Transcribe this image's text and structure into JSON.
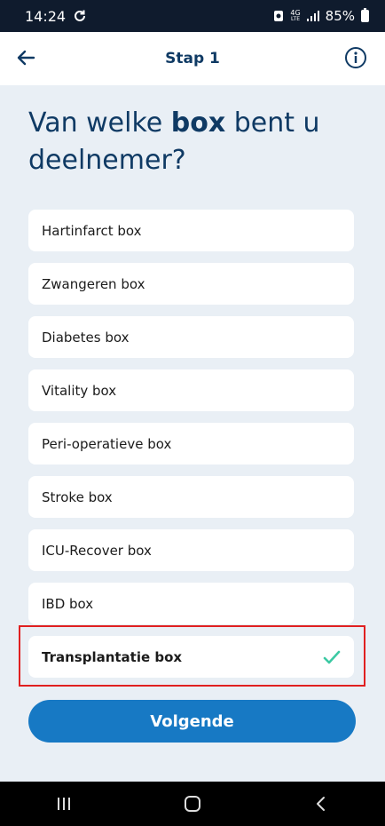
{
  "status_bar": {
    "time": "14:24",
    "network_top": "4G",
    "network_bottom": "LTE",
    "battery": "85%"
  },
  "header": {
    "title": "Stap 1"
  },
  "question": {
    "prefix": "Van welke ",
    "bold": "box",
    "suffix": " bent u deelnemer?"
  },
  "boxes": [
    {
      "label": "Hartinfarct box",
      "selected": false
    },
    {
      "label": "Zwangeren box",
      "selected": false
    },
    {
      "label": "Diabetes box",
      "selected": false
    },
    {
      "label": "Vitality box",
      "selected": false
    },
    {
      "label": "Peri-operatieve box",
      "selected": false
    },
    {
      "label": "Stroke box",
      "selected": false
    },
    {
      "label": "ICU-Recover box",
      "selected": false
    },
    {
      "label": "IBD box",
      "selected": false
    },
    {
      "label": "Transplantatie box",
      "selected": true
    }
  ],
  "next_button": {
    "label": "Volgende"
  },
  "colors": {
    "accent": "#1779c4",
    "title": "#0f3a64",
    "check": "#3cc9a3",
    "highlight": "#e02020"
  }
}
